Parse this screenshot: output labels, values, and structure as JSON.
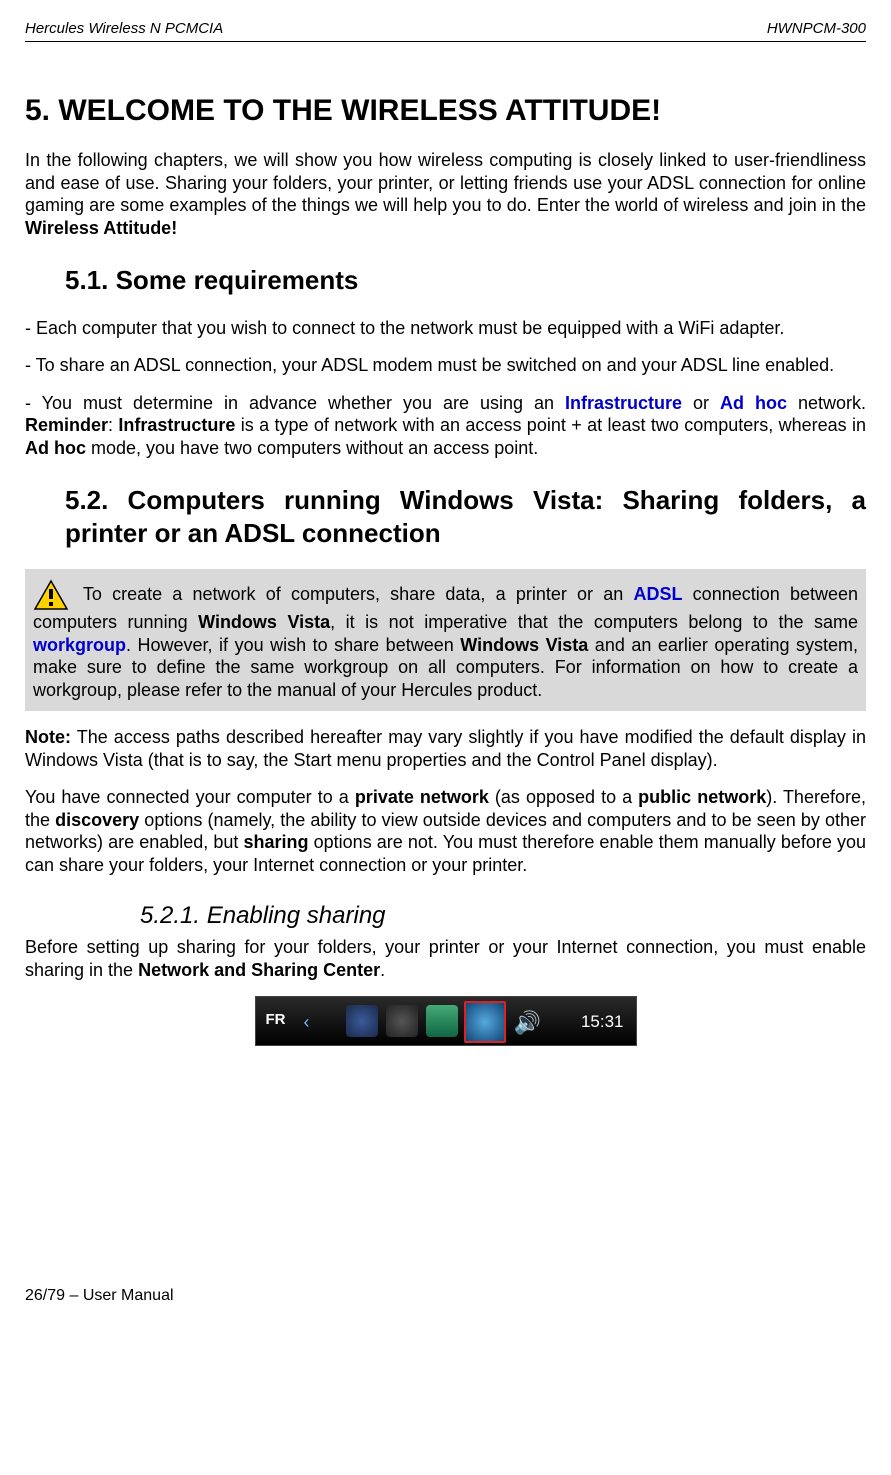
{
  "header": {
    "left": "Hercules Wireless N PCMCIA",
    "right": "HWNPCM-300"
  },
  "h1": "5.   WELCOME TO THE WIRELESS ATTITUDE!",
  "intro": {
    "t1": "In the following chapters, we will show you how wireless computing is closely linked to user-friendliness and ease of use.  Sharing your folders, your printer, or letting friends use your ADSL connection for online gaming are some examples of the things we will help you to do.  Enter the world of wireless and join in the ",
    "b1": "Wireless Attitude!"
  },
  "h2a": "5.1.  Some requirements",
  "req1": "- Each computer that you wish to connect to the network must be equipped with a WiFi adapter.",
  "req2": "- To share an ADSL connection, your ADSL modem must be switched on and your ADSL line enabled.",
  "req3": {
    "t1": "- You must determine in advance whether you are using an ",
    "l1": "Infrastructure",
    "t2": " or ",
    "l2": "Ad hoc",
    "t3": " network.  ",
    "b1": "Reminder",
    "t4": ": ",
    "b2": "Infrastructure",
    "t5": " is a type of network with an access point + at least two computers, whereas in ",
    "b3": "Ad hoc",
    "t6": " mode, you have two computers without an access point."
  },
  "h2b": "5.2.  Computers   running   Windows Vista:   Sharing   folders,   a printer or an ADSL connection",
  "greybox": {
    "t1": " To create a network of computers, share data, a printer or an ",
    "l1": "ADSL",
    "t2": " connection between computers running ",
    "b1": "Windows Vista",
    "t3": ", it is not imperative that the computers belong to the same ",
    "l2": "workgroup",
    "t4": ".  However, if you wish to share between ",
    "b2": "Windows Vista",
    "t5": " and an earlier operating system, make sure to define the same workgroup on all computers.  For information on how to create a workgroup, please refer to the manual of your Hercules product."
  },
  "note": {
    "b1": "Note:",
    "t1": " The access paths described hereafter may vary slightly if you have modified the default display in Windows Vista (that is to say, the Start menu properties and the Control Panel display)."
  },
  "para2": {
    "t1": "You have connected your computer to a ",
    "b1": "private network",
    "t2": " (as opposed to a ",
    "b2": "public network",
    "t3": ").  Therefore, the ",
    "b3": "discovery",
    "t4": " options (namely, the ability to view outside devices and computers and to be seen by other networks) are enabled, but ",
    "b4": "sharing",
    "t5": " options are not.  You must therefore enable them manually before you can share your folders, your Internet connection or your printer."
  },
  "h3": "5.2.1. Enabling sharing",
  "para3": {
    "t1": "Before setting up sharing for your folders, your printer or your Internet connection, you must enable sharing in the ",
    "b1": "Network and Sharing Center",
    "t2": "."
  },
  "taskbar": {
    "lang": "FR",
    "time": "15:31"
  },
  "footer": "26/79 – User Manual"
}
